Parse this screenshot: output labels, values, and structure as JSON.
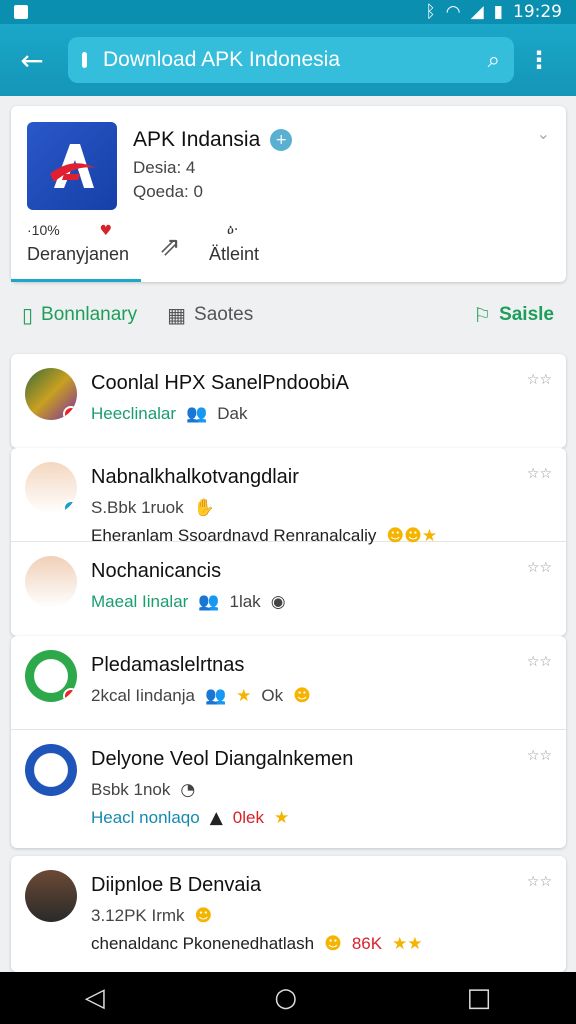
{
  "status_bar": {
    "time": "19:29",
    "icons": [
      "bluetooth-icon",
      "wifi-icon",
      "signal-icon",
      "battery-icon"
    ]
  },
  "app_bar": {
    "search_text": "Download APK Indonesia"
  },
  "header": {
    "title": "APK Indansia",
    "meta1": "Desia: 4",
    "meta2": "Qoeda: 0",
    "stat_left": "·10%",
    "tab_left": "Deranyjanen",
    "stat_right": "ዕ·",
    "tab_right": "Ätleint"
  },
  "filters": {
    "left": "Bonnlanary",
    "middle": "Saotes",
    "right": "Saisle"
  },
  "rows": [
    {
      "title": "Coonlal HPX SanelPndoobiA",
      "sub": "Heeclinalar",
      "sub2": "Dak"
    },
    {
      "title": "Nabnalkhalkotvangdlair",
      "sub": "S.Bbk 1ruok",
      "extra": "Eheranlam Ssoardnavd Renranalcaliy"
    },
    {
      "title": "Nochanicancis",
      "sub": "Maeal Iinalar",
      "sub2": "1lak"
    },
    {
      "title": "Pledamaslelrtnas",
      "sub": "2kcal Iindanja",
      "sub2": "Ok"
    },
    {
      "title": "Delyone Veol Diangalnkemen",
      "sub": "Bsbk 1nok",
      "sub3": "Heacl nonlaqo",
      "sub4": "0lek"
    },
    {
      "title": "Diipnloe B Denvaia",
      "sub": "3.12PK Irmk",
      "extra": "chenaldanc Pkonenedhatlash",
      "extra_red": "86K"
    }
  ]
}
